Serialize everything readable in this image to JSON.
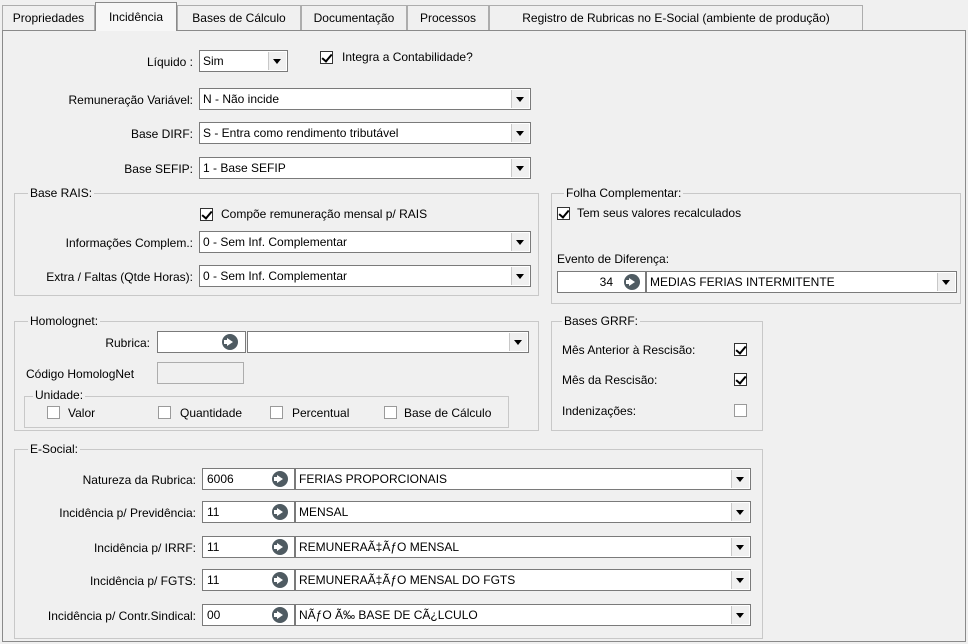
{
  "tabs": [
    "Propriedades",
    "Incidência",
    "Bases de Cálculo",
    "Documentação",
    "Processos",
    "Registro de Rubricas no E-Social (ambiente de produção)"
  ],
  "liquido": {
    "label": "Líquido :",
    "value": "Sim"
  },
  "integra": {
    "label": "Integra a Contabilidade?",
    "checked": true
  },
  "remuneracao": {
    "label": "Remuneração Variável:",
    "value": "N - Não incide"
  },
  "base_dirf": {
    "label": "Base DIRF:",
    "value": "S - Entra como rendimento tributável"
  },
  "base_sefip": {
    "label": "Base SEFIP:",
    "value": "1 - Base SEFIP"
  },
  "rais": {
    "title": "Base RAIS:",
    "compoe": {
      "label": "Compõe remuneração mensal p/ RAIS",
      "checked": true
    },
    "informacoes": {
      "label": "Informações Complem.:",
      "value": "0 - Sem Inf. Complementar"
    },
    "extra": {
      "label": "Extra / Faltas (Qtde Horas):",
      "value": "0 - Sem Inf. Complementar"
    }
  },
  "folha": {
    "title": "Folha Complementar:",
    "recalc": {
      "label": "Tem seus valores recalculados",
      "checked": true
    },
    "evento_label": "Evento de Diferença:",
    "evento_code": "34",
    "evento_desc": "MEDIAS FERIAS INTERMITENTE"
  },
  "homolognet": {
    "title": "Homolognet:",
    "rubrica_label": "Rubrica:",
    "rubrica_code": "",
    "rubrica_desc": "",
    "codigo_label": "Código HomologNet",
    "codigo_value": "",
    "unidade": {
      "title": "Unidade:",
      "valor": "Valor",
      "quantidade": "Quantidade",
      "percentual": "Percentual",
      "base": "Base de Cálculo"
    }
  },
  "grrf": {
    "title": "Bases GRRF:",
    "mes_anterior": {
      "label": "Mês Anterior à Rescisão:",
      "checked": true
    },
    "mes_rescisao": {
      "label": "Mês da Rescisão:",
      "checked": true
    },
    "indenizacoes": {
      "label": "Indenizações:",
      "checked": false
    }
  },
  "esocial": {
    "title": "E-Social:",
    "rows": [
      {
        "label": "Natureza da Rubrica:",
        "code": "6006",
        "desc": "FERIAS PROPORCIONAIS"
      },
      {
        "label": "Incidência p/ Previdência:",
        "code": "11",
        "desc": "MENSAL"
      },
      {
        "label": "Incidência p/ IRRF:",
        "code": "11",
        "desc": "REMUNERAÃ‡ÃƒO MENSAL"
      },
      {
        "label": "Incidência p/ FGTS:",
        "code": "11",
        "desc": "REMUNERAÃ‡ÃƒO MENSAL DO FGTS"
      },
      {
        "label": "Incidência p/ Contr.Sindical:",
        "code": "00",
        "desc": "NÃƒO Ã‰ BASE DE CÃ¿LCULO"
      }
    ]
  },
  "icons": {
    "lookup": "lookup-arrow-icon",
    "dropdown": "chevron-down-icon",
    "check": "checkmark-icon"
  }
}
